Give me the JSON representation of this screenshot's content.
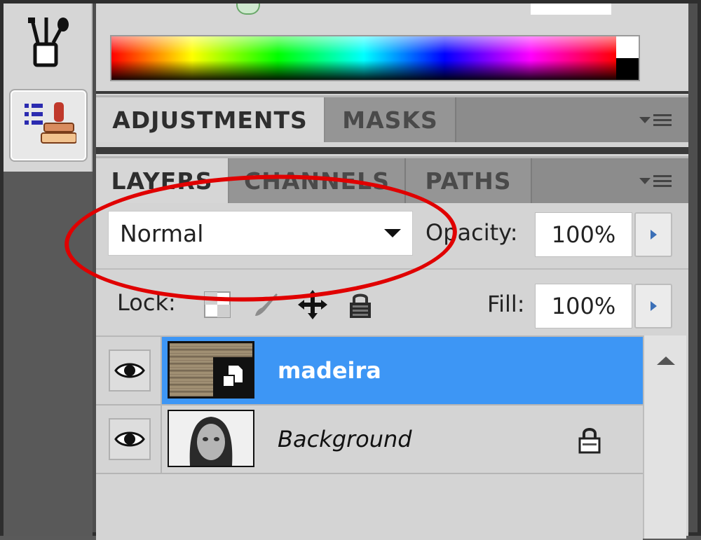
{
  "colors": {
    "accent_selected": "#3d96f5",
    "annotation_circle": "#e00000"
  },
  "toolstrip": {
    "tools": [
      {
        "icon": "brush-presets-icon"
      },
      {
        "icon": "clone-source-icon",
        "active": true
      }
    ]
  },
  "color_panel": {
    "spectrum_icon": "color-spectrum"
  },
  "adjustments_panel": {
    "tabs": [
      {
        "label": "ADJUSTMENTS",
        "active": true
      },
      {
        "label": "MASKS",
        "active": false
      }
    ]
  },
  "layers_panel": {
    "tabs": [
      {
        "label": "LAYERS",
        "active": true
      },
      {
        "label": "CHANNELS",
        "active": false
      },
      {
        "label": "PATHS",
        "active": false
      }
    ],
    "blend_mode": "Normal",
    "opacity_label": "Opacity:",
    "opacity_value": "100%",
    "lock_label": "Lock:",
    "lock_icons": [
      "lock-transparent-pixels-icon",
      "lock-image-pixels-icon",
      "lock-position-icon",
      "lock-all-icon"
    ],
    "fill_label": "Fill:",
    "fill_value": "100%",
    "layers": [
      {
        "name": "madeira",
        "selected": true,
        "visible": true,
        "smart_object": true,
        "locked": false
      },
      {
        "name": "Background",
        "selected": false,
        "visible": true,
        "smart_object": false,
        "locked": true
      }
    ]
  }
}
